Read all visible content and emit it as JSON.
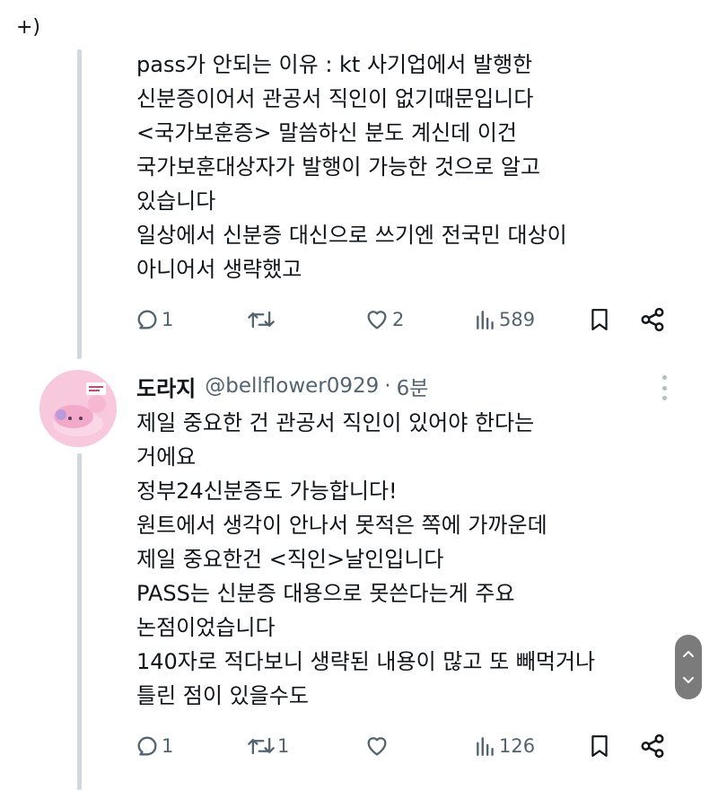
{
  "fragment_top": "+)",
  "tweet1": {
    "lines": [
      "pass가 안되는 이유 : kt 사기업에서 발행한",
      "신분증이어서 관공서 직인이 없기때문입니다",
      "<국가보훈증> 말씀하신 분도 계신데 이건",
      "국가보훈대상자가 발행이 가능한 것으로 알고",
      "있습니다",
      "일상에서 신분증 대신으로 쓰기엔 전국민 대상이",
      "아니어서 생략했고"
    ],
    "reply_count": "1",
    "retweet_count": "",
    "like_count": "2",
    "view_count": "589"
  },
  "tweet2": {
    "display_name": "도라지",
    "handle": "@bellflower0929",
    "separator": "·",
    "time": "6분",
    "lines": [
      "제일 중요한 건 관공서 직인이 있어야 한다는",
      "거에요",
      "정부24신분증도 가능합니다!",
      "원트에서 생각이 안나서 못적은 쪽에 가까운데",
      "제일 중요한건 <직인>날인입니다",
      "PASS는 신분증 대용으로 못쓴다는게 주요",
      "논점이었습니다",
      "140자로 적다보니 생략된 내용이 많고 또 빼먹거나",
      "틀린 점이 있을수도"
    ],
    "reply_count": "1",
    "retweet_count": "1",
    "like_count": "",
    "view_count": "126"
  },
  "icons": {
    "reply": "speech-bubble-icon",
    "retweet": "retweet-arrows-icon",
    "like": "heart-icon",
    "views": "bar-chart-icon",
    "bookmark": "bookmark-icon",
    "share": "share-icon",
    "more": "more-dots-icon",
    "scroll": "scroll-up-down-icon"
  },
  "colors": {
    "text": "#0f1419",
    "muted": "#536471",
    "thread_line": "#cfd9de",
    "avatar_bg": "#f8c9dc"
  }
}
